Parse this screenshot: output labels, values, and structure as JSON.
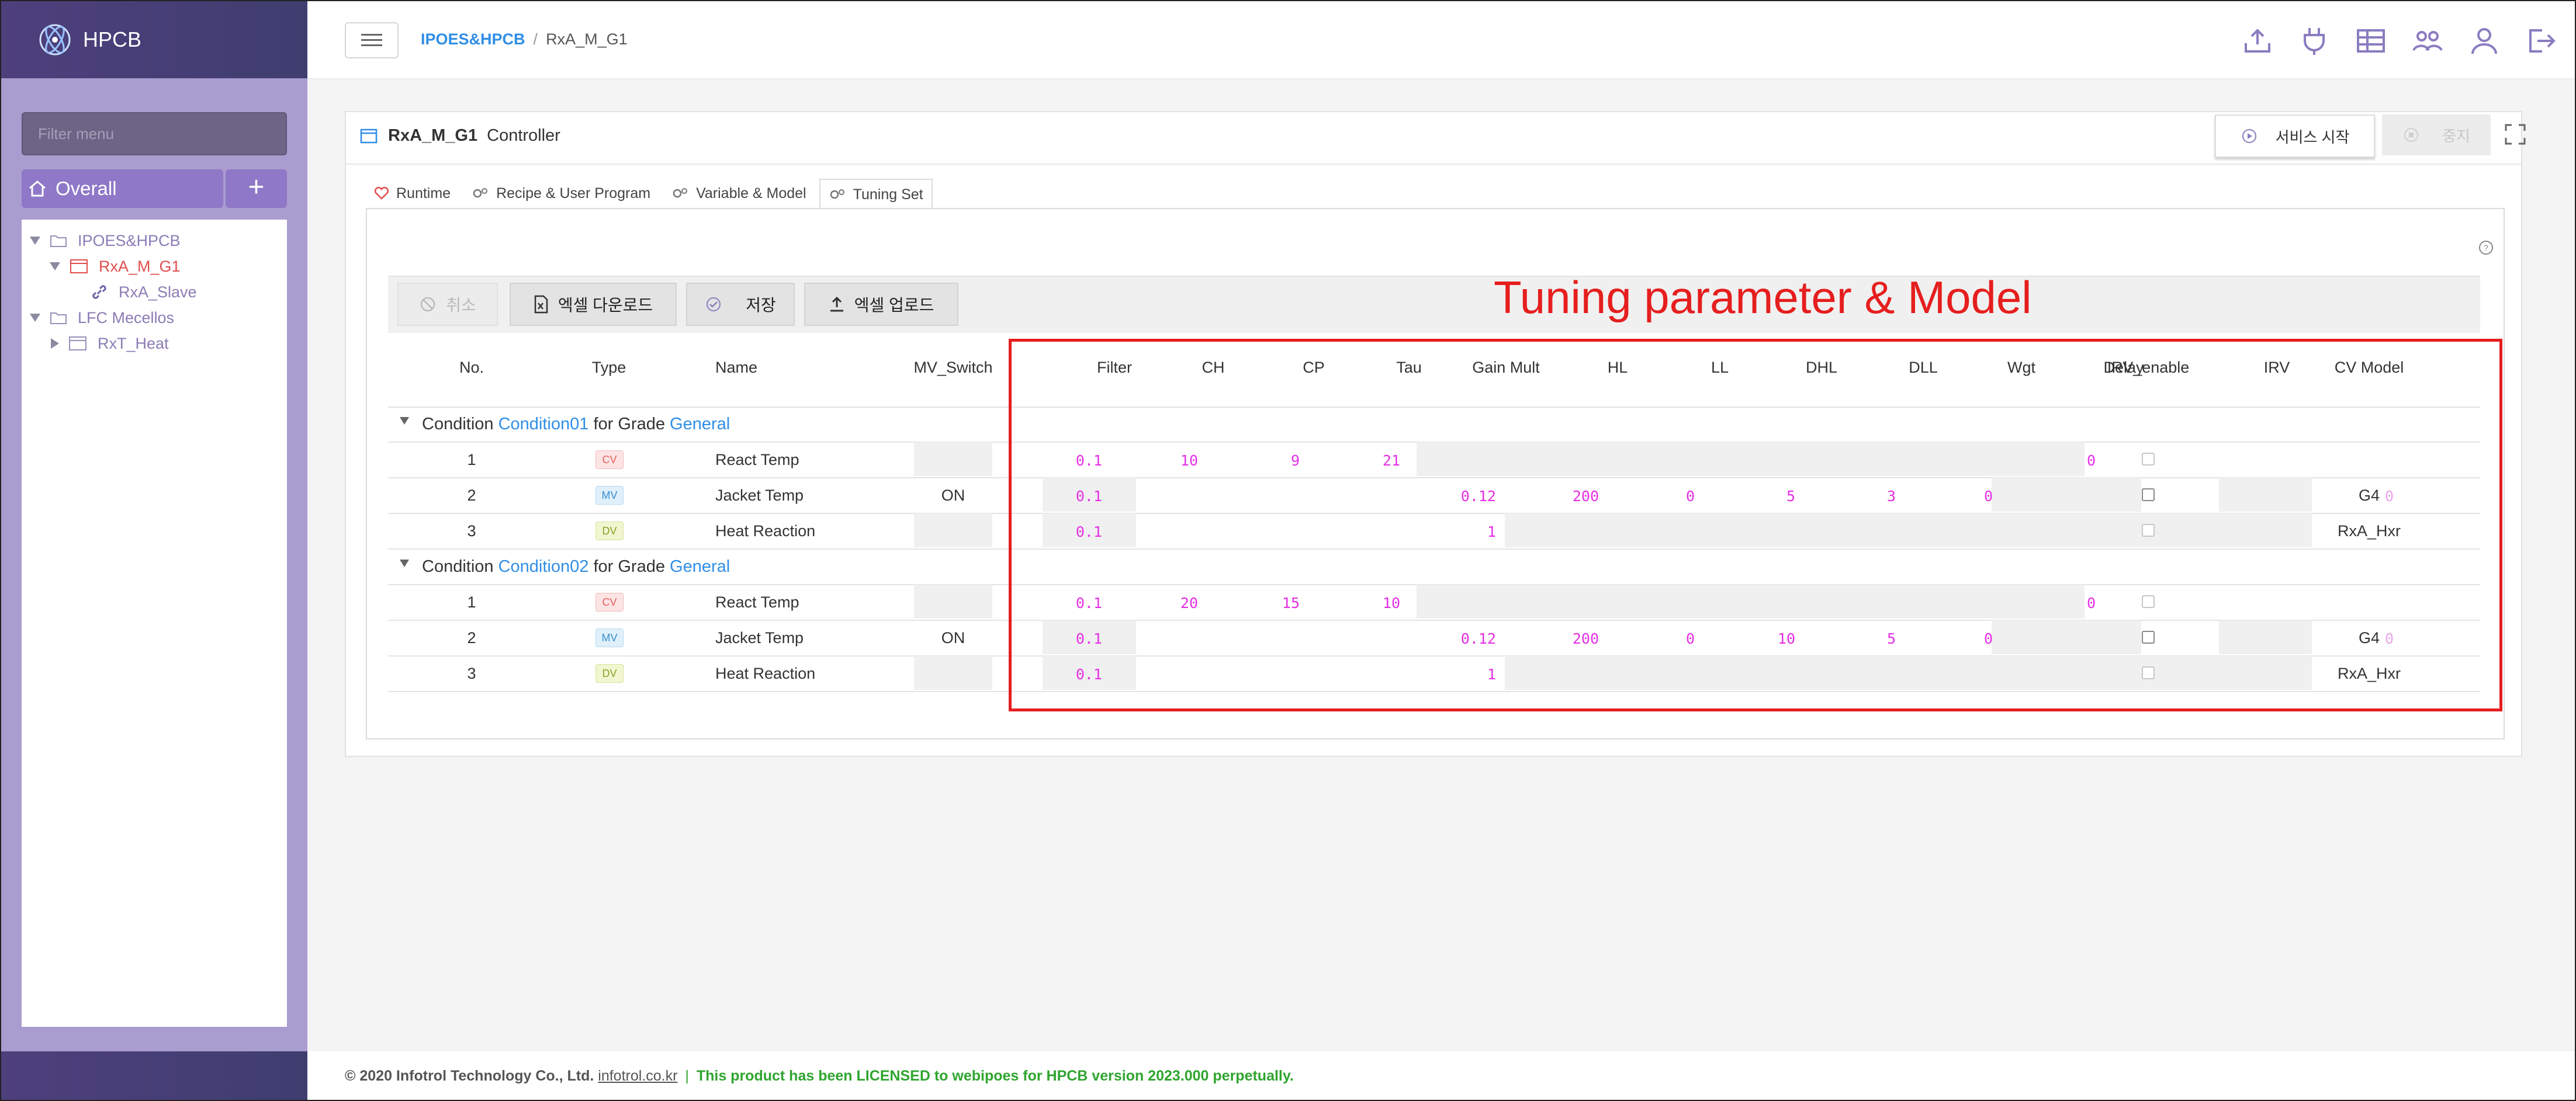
{
  "app": {
    "title": "HPCB"
  },
  "sidebar": {
    "filter_placeholder": "Filter menu",
    "overall_label": "Overall",
    "add_label": "+",
    "tree": [
      {
        "label": "IPOES&HPCB",
        "kind": "folder",
        "expanded": true
      },
      {
        "label": "RxA_M_G1",
        "kind": "controller",
        "expanded": true,
        "selected": true
      },
      {
        "label": "RxA_Slave",
        "kind": "link"
      },
      {
        "label": "LFC Mecellos",
        "kind": "folder",
        "expanded": true
      },
      {
        "label": "RxT_Heat",
        "kind": "controller",
        "expanded": false
      }
    ]
  },
  "breadcrumb": {
    "root": "IPOES&HPCB",
    "sep": "/",
    "current": "RxA_M_G1"
  },
  "top_icons": [
    "upload-icon",
    "plug-icon",
    "table-icon",
    "group-icon",
    "user-icon",
    "logout-icon"
  ],
  "panel": {
    "name": "RxA_M_G1",
    "kind": "Controller",
    "start_label": "서비스 시작",
    "stop_label": "중지"
  },
  "tabs": [
    "Runtime",
    "Recipe & User Program",
    "Variable & Model",
    "Tuning Set"
  ],
  "active_tab": "Tuning Set",
  "toolbar": {
    "cancel": "취소",
    "excel_download": "엑셀 다운로드",
    "save": "저장",
    "excel_upload": "엑셀 업로드"
  },
  "columns": [
    "No.",
    "Type",
    "Name",
    "MV_Switch",
    "Filter",
    "CH",
    "CP",
    "Tau",
    "Gain Mult",
    "HL",
    "LL",
    "DHL",
    "DLL",
    "Wgt",
    "Delay",
    "IRV_enable",
    "IRV",
    "CV Model"
  ],
  "groups": [
    {
      "prefix": "Condition",
      "condition": "Condition01",
      "mid": "for Grade",
      "grade": "General",
      "rows": [
        {
          "no": "1",
          "type": "CV",
          "name": "React Temp",
          "mv_switch": "",
          "filter": "0.1",
          "ch": "10",
          "cp": "9",
          "tau": "21",
          "gain": "",
          "hl": "",
          "ll": "",
          "dhl": "",
          "dll": "",
          "wgt": "",
          "delay": "0",
          "irv_enable": false,
          "irv": "",
          "cv_model": ""
        },
        {
          "no": "2",
          "type": "MV",
          "name": "Jacket Temp",
          "mv_switch": "ON",
          "filter": "0.1",
          "ch": "",
          "cp": "",
          "tau": "",
          "gain": "0.12",
          "hl": "200",
          "ll": "0",
          "dhl": "5",
          "dll": "3",
          "wgt": "0",
          "delay": "",
          "irv_enable": false,
          "irv": "0",
          "cv_model": "G4"
        },
        {
          "no": "3",
          "type": "DV",
          "name": "Heat Reaction",
          "mv_switch": "",
          "filter": "0.1",
          "ch": "",
          "cp": "",
          "tau": "",
          "gain": "1",
          "hl": "",
          "ll": "",
          "dhl": "",
          "dll": "",
          "wgt": "",
          "delay": "",
          "irv_enable": false,
          "irv": "",
          "cv_model": "RxA_Hxr"
        }
      ]
    },
    {
      "prefix": "Condition",
      "condition": "Condition02",
      "mid": "for Grade",
      "grade": "General",
      "rows": [
        {
          "no": "1",
          "type": "CV",
          "name": "React Temp",
          "mv_switch": "",
          "filter": "0.1",
          "ch": "20",
          "cp": "15",
          "tau": "10",
          "gain": "",
          "hl": "",
          "ll": "",
          "dhl": "",
          "dll": "",
          "wgt": "",
          "delay": "0",
          "irv_enable": false,
          "irv": "",
          "cv_model": ""
        },
        {
          "no": "2",
          "type": "MV",
          "name": "Jacket Temp",
          "mv_switch": "ON",
          "filter": "0.1",
          "ch": "",
          "cp": "",
          "tau": "",
          "gain": "0.12",
          "hl": "200",
          "ll": "0",
          "dhl": "10",
          "dll": "5",
          "wgt": "0",
          "delay": "",
          "irv_enable": false,
          "irv": "0",
          "cv_model": "G4"
        },
        {
          "no": "3",
          "type": "DV",
          "name": "Heat Reaction",
          "mv_switch": "",
          "filter": "0.1",
          "ch": "",
          "cp": "",
          "tau": "",
          "gain": "1",
          "hl": "",
          "ll": "",
          "dhl": "",
          "dll": "",
          "wgt": "",
          "delay": "",
          "irv_enable": false,
          "irv": "",
          "cv_model": "RxA_Hxr"
        }
      ]
    }
  ],
  "annotation": "Tuning parameter & Model",
  "footer": {
    "copyright": "© 2020 Infotrol Technology Co., Ltd.",
    "link": "infotrol.co.kr",
    "sep": "|",
    "license": "This product has been LICENSED to webipoes for HPCB version 2023.000 perpetually."
  },
  "colors": {
    "accent": "#2f8ee6",
    "value": "#e52fe5",
    "annotation": "#e61e1e",
    "sidebar": "#a99dcf"
  }
}
